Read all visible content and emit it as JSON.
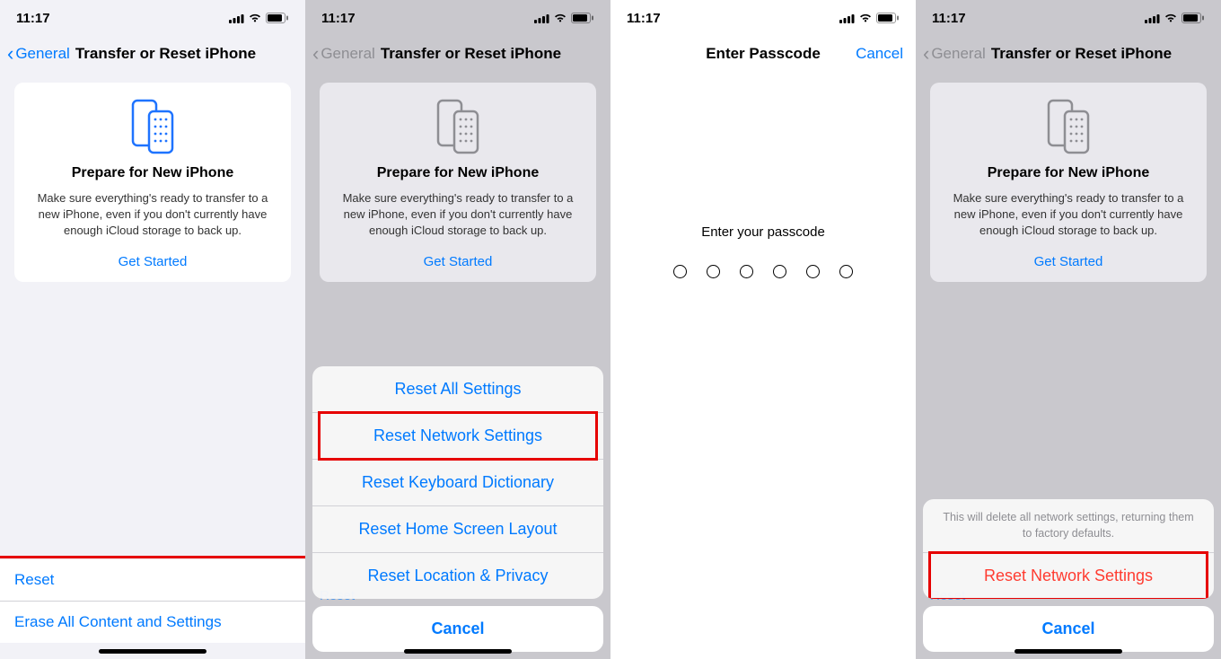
{
  "status": {
    "time": "11:17"
  },
  "nav": {
    "back_label": "General",
    "title": "Transfer or Reset iPhone",
    "passcode_title": "Enter Passcode",
    "cancel_label": "Cancel"
  },
  "card": {
    "title": "Prepare for New iPhone",
    "desc": "Make sure everything's ready to transfer to a new iPhone, even if you don't currently have enough iCloud storage to back up.",
    "cta": "Get Started"
  },
  "screen1": {
    "reset_label": "Reset",
    "erase_label": "Erase All Content and Settings"
  },
  "reset_sheet": {
    "items": [
      "Reset All Settings",
      "Reset Network Settings",
      "Reset Keyboard Dictionary",
      "Reset Home Screen Layout",
      "Reset Location & Privacy"
    ],
    "cancel": "Cancel",
    "bg_hint": "Reset"
  },
  "passcode": {
    "prompt": "Enter your passcode"
  },
  "confirm_sheet": {
    "desc": "This will delete all network settings, returning them to factory defaults.",
    "action": "Reset Network Settings",
    "cancel": "Cancel",
    "bg_hint": "Reset"
  }
}
